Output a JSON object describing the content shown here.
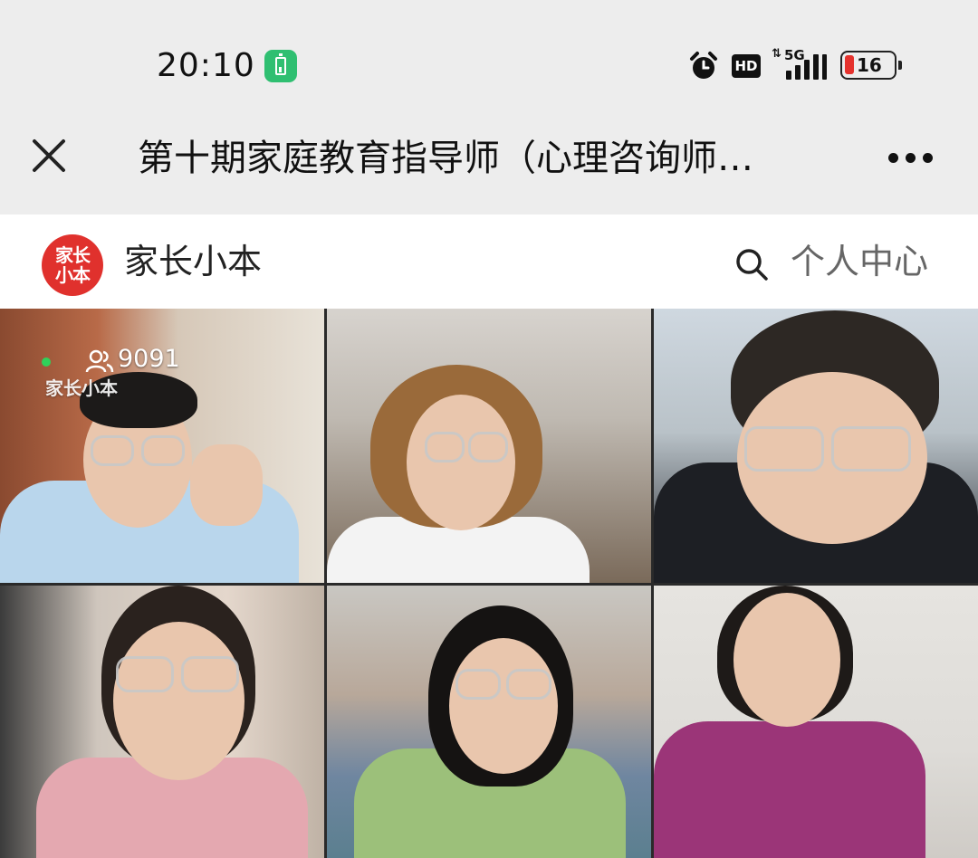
{
  "status_bar": {
    "time": "20:10",
    "charging_icon": "battery-charging-icon",
    "alarm_icon": "alarm-clock-icon",
    "hd_label": "HD",
    "network_label": "5G",
    "battery_level": "16",
    "battery_color": "#e5322d"
  },
  "title_bar": {
    "close_icon": "close-icon",
    "title": "第十期家庭教育指导师（心理咨询师…",
    "more_icon": "more-dots-icon"
  },
  "app_header": {
    "logo_text": "家长小本",
    "logo_color": "#e0312d",
    "app_name": "家长小本",
    "search_icon": "search-icon",
    "personal_center": "个人中心"
  },
  "video_grid": {
    "viewer_count": "9091",
    "watermark": "家长小本",
    "live_indicator_color": "#2fd25a",
    "tiles": [
      "participant-1",
      "participant-2",
      "participant-3",
      "participant-4",
      "participant-5",
      "participant-6"
    ]
  }
}
